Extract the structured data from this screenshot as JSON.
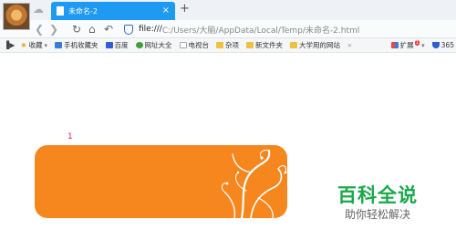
{
  "browser": {
    "tab": {
      "title": "未命名-2",
      "close": "×"
    },
    "new_tab": "+",
    "address": {
      "scheme": "file:///",
      "path": "C:/Users/大脑/AppData/Local/Temp/未命名-2.html"
    },
    "nav": {
      "back": "❮",
      "forward": "❯",
      "reload": "↻",
      "home": "⌂",
      "undo": "↶"
    },
    "bookmarks": [
      {
        "label": "收藏",
        "color": "#e7a400",
        "has_arrow": true
      },
      {
        "label": "手机收藏夹",
        "color": "#3a7bd5"
      },
      {
        "label": "百度",
        "color": "#2f5fd0"
      },
      {
        "label": "网址大全",
        "color": "#3aa03a"
      },
      {
        "label": "电视台",
        "color": "#bbbbbb"
      },
      {
        "label": "杂项",
        "color": "#f0c040"
      },
      {
        "label": "新文件夹",
        "color": "#f0c040"
      },
      {
        "label": "大学用的网站",
        "color": "#f0c040"
      }
    ],
    "more": "»",
    "extensions": {
      "label": "扩展",
      "badge": "1"
    },
    "security": {
      "label": "365"
    }
  },
  "page": {
    "marker": "1",
    "banner_color": "#f6871f",
    "watermark": {
      "title": "百科全说",
      "subtitle": "助你轻松解决"
    }
  }
}
